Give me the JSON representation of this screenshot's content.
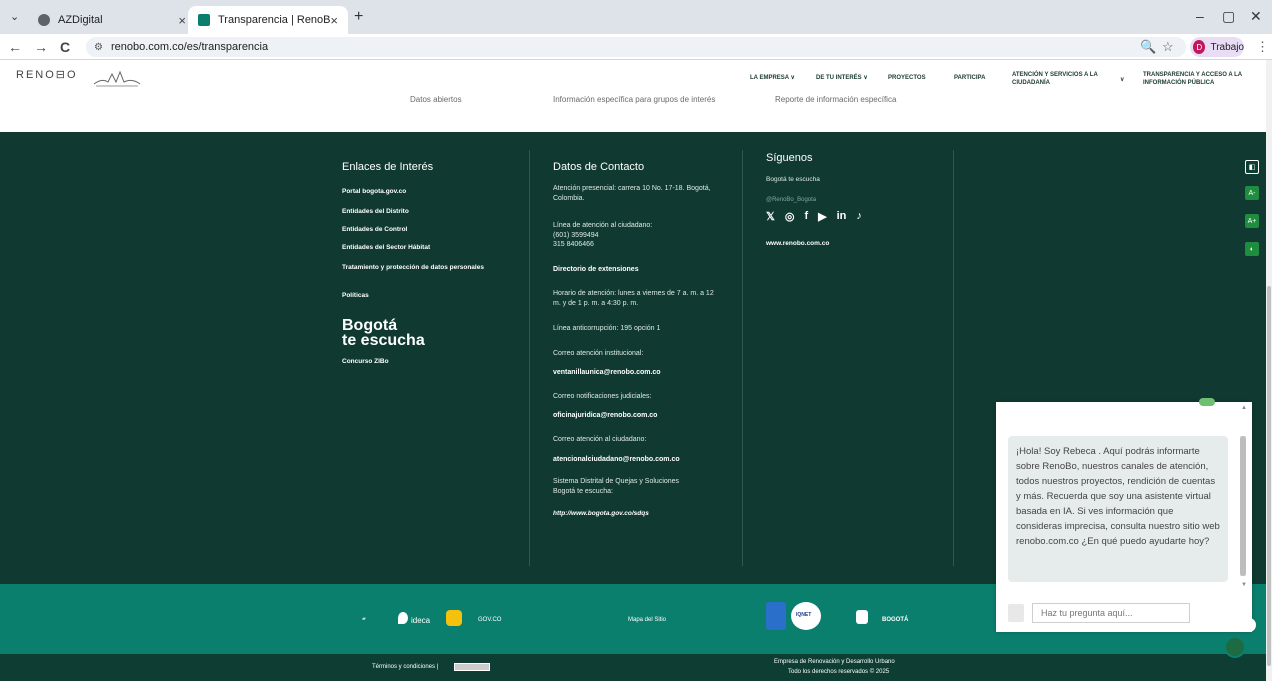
{
  "browser": {
    "tabs": [
      {
        "title": "AZDigital",
        "active": false
      },
      {
        "title": "Transparencia | RenoBo",
        "active": true
      }
    ],
    "url": "renobo.com.co/es/transparencia",
    "profile": {
      "initial": "D",
      "label": "Trabajo"
    },
    "icons": {
      "back": "←",
      "forward": "→",
      "reload": "C",
      "tune": "⚙",
      "zoom": "🔍",
      "star": "☆",
      "menu": "⋮",
      "min": "–",
      "max": "▢",
      "close": "✕",
      "newtab": "+",
      "tabs_dropdown": "⌄",
      "tabclose": "×"
    }
  },
  "site": {
    "logo": "RENO⊟O",
    "menu": [
      "LA EMPRESA ∨",
      "DE TU INTERÉS ∨",
      "PROYECTOS",
      "PARTICIPA",
      "ATENCIÓN Y SERVICIOS A LA CIUDADANÍA",
      "∨",
      "TRANSPARENCIA Y ACCESO A LA INFORMACIÓN PÚBLICA"
    ],
    "sublinks": [
      "Datos abiertos",
      "Información específica para grupos de interés",
      "Reporte de información específica"
    ]
  },
  "footer": {
    "links_title": "Enlaces de Interés",
    "links": [
      "Portal bogota.gov.co",
      "Entidades del Distrito",
      "Entidades de Control",
      "Entidades del Sector Hábitat",
      "Tratamiento y protección de datos personales",
      "Políticas"
    ],
    "bte_line1": "Bogotá",
    "bte_line2": "te escucha",
    "concurso": "Concurso ZIBo",
    "contact_title": "Datos de Contacto",
    "contact": {
      "address": "Atención presencial: carrera 10 No. 17-18. Bogotá, Colombia.",
      "phone_label": "Línea de atención al ciudadano:",
      "phone1": "(601) 3599494",
      "phone2": "315 8406466",
      "directory": "Directorio de extensiones",
      "hours": "Horario de atención: lunes a viernes de 7 a. m. a 12 m. y de 1 p. m. a 4:30 p. m.",
      "anticorruption": "Línea anticorrupción: 195 opción 1",
      "inst_label": "Correo atención institucional:",
      "inst_email": "ventanillaunica@renobo.com.co",
      "judicial_label": "Correo notificaciones judiciales:",
      "judicial_email": "oficinajuridica@renobo.com.co",
      "citizen_label": "Correo atención al ciudadano:",
      "citizen_email": "atencionalciudadano@renobo.com.co",
      "quejas_label": "Sistema Distrital de Quejas y Soluciones Bogotá te escucha:",
      "quejas_url": "http://www.bogota.gov.co/sdqs"
    },
    "follow_title": "Síguenos",
    "follow_line1": "Bogotá te escucha",
    "follow_handle": "@RenoBo_Bogota",
    "social_icons": [
      "𝕏",
      "◎",
      "f",
      "▶",
      "in",
      "♪"
    ],
    "website": "www.renobo.com.co",
    "bar1": {
      "ideca": "ideca",
      "govco": "GOV.CO",
      "sitemap": "Mapa del Sitio",
      "bogota": "BOGOTÁ",
      "icontec": "IQNET"
    },
    "bar2": {
      "terms": "Términos y condiciones |",
      "company": "Empresa de Renovación y Desarrollo Urbano",
      "rights": "Todo los derechos reservados © 2025"
    }
  },
  "accessibility": [
    "◧",
    "A-",
    "A+",
    "◐"
  ],
  "chat": {
    "message": "¡Hola! Soy Rebeca . Aquí podrás informarte sobre RenoBo, nuestros canales de atención, todos nuestros proyectos, rendición de cuentas y más. Recuerda que soy una asistente virtual basada en IA. Si ves información que consideras imprecisa, consulta nuestro sitio web renobo.com.co ¿En qué puedo ayudarte hoy?",
    "placeholder": "Haz tu pregunta aquí...",
    "arrow_up": "▲",
    "arrow_down": "▼"
  }
}
